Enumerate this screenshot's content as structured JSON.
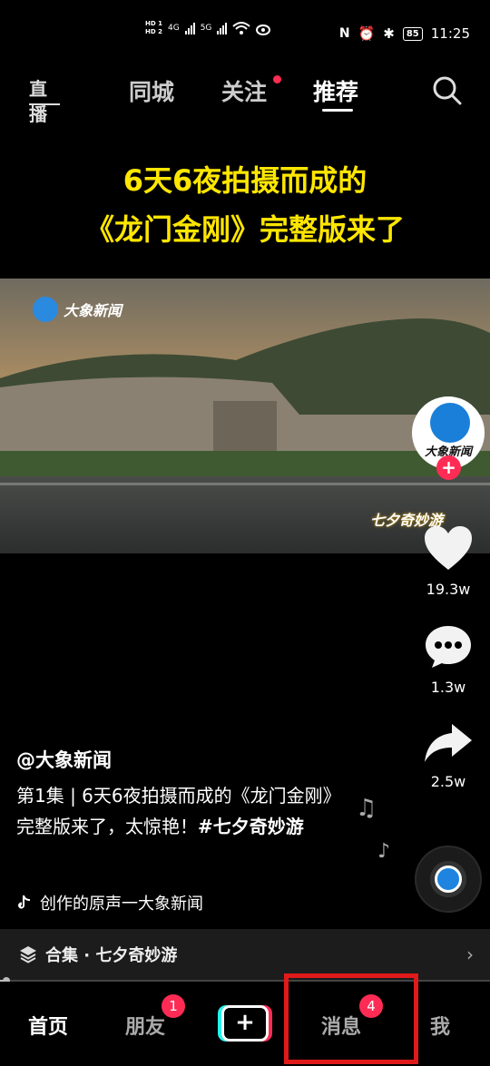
{
  "status_bar": {
    "hd1": "HD 1",
    "hd2": "HD 2",
    "net1": "4G",
    "net2": "5G",
    "battery": "85",
    "time": "11:25"
  },
  "top_nav": {
    "live_label": "直播",
    "tabs": [
      {
        "label": "同城"
      },
      {
        "label": "关注"
      },
      {
        "label": "推荐"
      }
    ]
  },
  "headline": {
    "line1": "6天6夜拍摄而成的",
    "line2": "《龙门金刚》完整版来了"
  },
  "video": {
    "watermark": "大象新闻",
    "corner_mark": "七夕奇妙游"
  },
  "right_rail": {
    "avatar_label": "大象新闻",
    "likes": "19.3w",
    "comments": "1.3w",
    "shares": "2.5w"
  },
  "caption": {
    "author": "@大象新闻",
    "desc_text": "第1集 | 6天6夜拍摄而成的《龙门金刚》完整版来了，太惊艳！",
    "hashtag": "#七夕奇妙游",
    "sound": "创作的原声一大象新闻"
  },
  "collection": {
    "label": "合集 · 七夕奇妙游"
  },
  "playback": {
    "progress_fraction": 0.01
  },
  "bottom_nav": {
    "home": "首页",
    "friends": "朋友",
    "friends_badge": "1",
    "create": "+",
    "messages": "消息",
    "messages_badge": "4",
    "me": "我"
  },
  "colors": {
    "accent_red": "#fe2c55",
    "headline_yellow": "#ffe600",
    "annotation_red": "#e01a1a"
  }
}
